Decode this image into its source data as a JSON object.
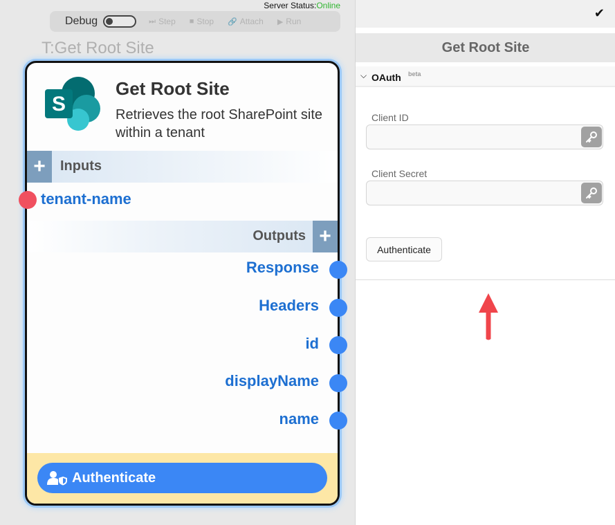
{
  "server_status": {
    "label": "Server Status:",
    "value": "Online"
  },
  "debug": {
    "label": "Debug",
    "buttons": [
      {
        "label": "Step",
        "icon": "step-icon"
      },
      {
        "label": "Stop",
        "icon": "stop-icon"
      },
      {
        "label": "Attach",
        "icon": "link-icon"
      },
      {
        "label": "Run",
        "icon": "play-icon"
      }
    ]
  },
  "canvas": {
    "node_label": "T:Get Root Site"
  },
  "node": {
    "title": "Get Root Site",
    "description": "Retrieves the root SharePoint site within a tenant",
    "inputs_label": "Inputs",
    "inputs": [
      "tenant-name"
    ],
    "outputs_label": "Outputs",
    "outputs": [
      "Response",
      "Headers",
      "id",
      "displayName",
      "name"
    ],
    "auth_button": "Authenticate"
  },
  "panel": {
    "title": "Get Root Site",
    "section": {
      "label": "OAuth",
      "badge": "beta"
    },
    "client_id": {
      "label": "Client ID",
      "value": "",
      "placeholder": ""
    },
    "client_secret": {
      "label": "Client Secret",
      "value": "",
      "placeholder": ""
    },
    "auth_button": "Authenticate"
  },
  "colors": {
    "accent_blue": "#3b87f5",
    "port_input": "#f0505f",
    "status_online": "#2fb52f",
    "footer_yellow": "#fde7a6",
    "arrow_red": "#f0454b"
  }
}
